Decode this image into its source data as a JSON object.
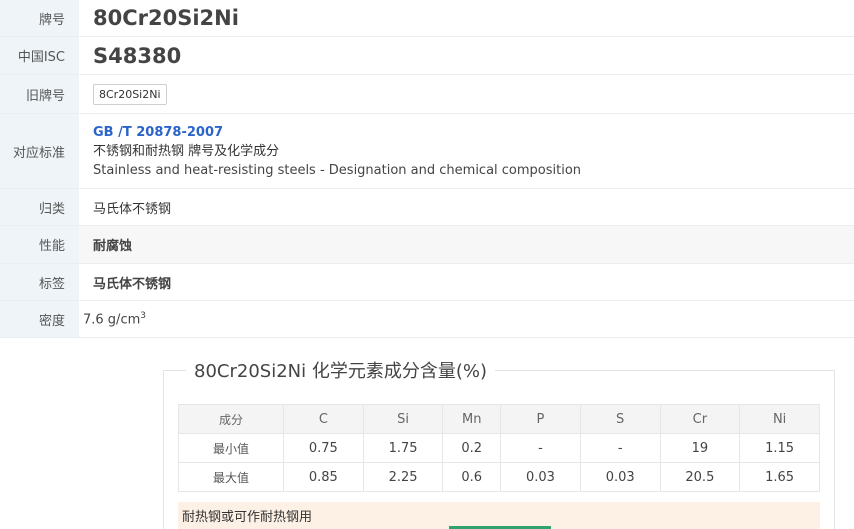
{
  "info": {
    "grade_label": "牌号",
    "grade_value": "80Cr20Si2Ni",
    "isc_label": "中国ISC",
    "isc_value": "S48380",
    "old_label": "旧牌号",
    "old_value": "8Cr20Si2Ni",
    "standard_label": "对应标准",
    "standard_code": "GB /T 20878-2007",
    "standard_cn": "不锈钢和耐热钢 牌号及化学成分",
    "standard_en": "Stainless and heat-resisting steels - Designation and chemical composition",
    "category_label": "归类",
    "category_value": "马氏体不锈钢",
    "property_label": "性能",
    "property_value": "耐腐蚀",
    "tag_label": "标签",
    "tag_value": "马氏体不锈钢",
    "density_label": "密度",
    "density_value": "7.6 g/cm",
    "density_unit_exp": "3"
  },
  "composition": {
    "title": "80Cr20Si2Ni 化学元素成分含量(%)",
    "header_first": "成分",
    "elements": [
      "C",
      "Si",
      "Mn",
      "P",
      "S",
      "Cr",
      "Ni"
    ],
    "min_label": "最小值",
    "min_values": [
      "0.75",
      "1.75",
      "0.2",
      "-",
      "-",
      "19",
      "1.15"
    ],
    "max_label": "最大值",
    "max_values": [
      "0.85",
      "2.25",
      "0.6",
      "0.03",
      "0.03",
      "20.5",
      "1.65"
    ],
    "note": "耐热钢或可作耐热钢用"
  },
  "colors": {
    "label_bg": "#eef4f8",
    "link_blue": "#2a64c9",
    "note_bg": "#fdf1e6",
    "accent_green": "#2ea36b"
  }
}
